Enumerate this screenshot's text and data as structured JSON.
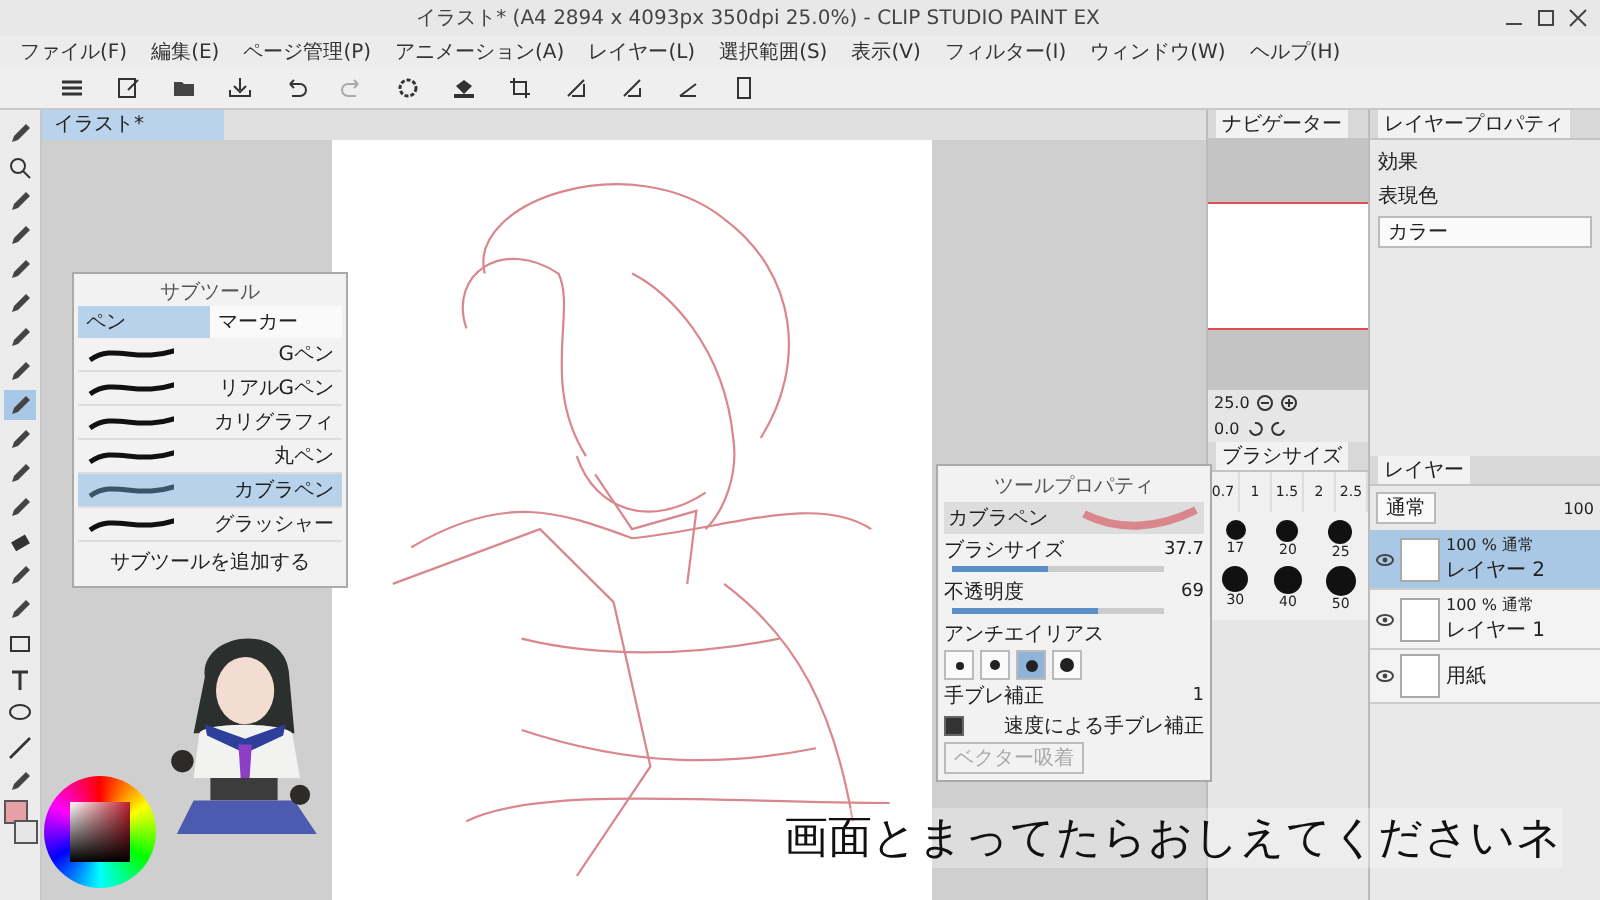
{
  "window": {
    "title": "イラスト* (A4 2894 x 4093px 350dpi 25.0%) - CLIP STUDIO PAINT EX"
  },
  "menu": [
    "ファイル(F)",
    "編集(E)",
    "ページ管理(P)",
    "アニメーション(A)",
    "レイヤー(L)",
    "選択範囲(S)",
    "表示(V)",
    "フィルター(I)",
    "ウィンドウ(W)",
    "ヘルプ(H)"
  ],
  "canvas_tab": {
    "label": "イラスト*"
  },
  "tools": [
    {
      "selected": false
    },
    {
      "selected": false
    },
    {
      "selected": false
    },
    {
      "selected": false
    },
    {
      "selected": false
    },
    {
      "selected": false
    },
    {
      "selected": false
    },
    {
      "selected": false
    },
    {
      "selected": true
    },
    {
      "selected": false
    },
    {
      "selected": false
    },
    {
      "selected": false
    },
    {
      "selected": false
    },
    {
      "selected": false
    },
    {
      "selected": false
    },
    {
      "selected": false
    },
    {
      "selected": false
    },
    {
      "selected": false
    },
    {
      "selected": false
    },
    {
      "selected": false
    }
  ],
  "sub_tool_panel": {
    "title": "サブツール",
    "tabs": [
      {
        "label": "ペン",
        "selected": true
      },
      {
        "label": "マーカー",
        "selected": false
      }
    ],
    "items": [
      {
        "label": "Gペン",
        "selected": false
      },
      {
        "label": "リアルGペン",
        "selected": false
      },
      {
        "label": "カリグラフィ",
        "selected": false
      },
      {
        "label": "丸ペン",
        "selected": false
      },
      {
        "label": "カブラペン",
        "selected": true
      },
      {
        "label": "グラッシャー",
        "selected": false
      }
    ],
    "add_button": "サブツールを追加する"
  },
  "tool_property": {
    "title": "ツールプロパティ",
    "preset": "カブラペン",
    "sliders": [
      {
        "label": "ブラシサイズ",
        "value": "37.7",
        "level": 0.45
      },
      {
        "label": "不透明度",
        "value": "69",
        "level": 0.69
      }
    ],
    "antialias": {
      "label": "アンチエイリアス",
      "options": [
        {
          "selected": false
        },
        {
          "selected": false
        },
        {
          "selected": true
        },
        {
          "selected": false
        }
      ]
    },
    "stabilization": {
      "label": "手ブレ補正",
      "value": "1"
    },
    "speed_stabilization": {
      "label": "速度による手ブレ補正",
      "checked": true
    },
    "vector_snap": {
      "label": "ベクター吸着",
      "disabled": true
    }
  },
  "navigator": {
    "tab": "ナビゲーター",
    "zoom": "25.0",
    "rotation": "0.0"
  },
  "brush_size_panel": {
    "tab": "ブラシサイズ",
    "grid_sizes": [
      "0.7",
      "1",
      "1.5",
      "2",
      "2.5"
    ],
    "dot_sizes": [
      "17",
      "20",
      "25",
      "30",
      "40",
      "50"
    ]
  },
  "layer_property": {
    "tab": "レイヤープロパティ",
    "effect_label": "効果",
    "color_label": "表現色",
    "color_value": "カラー"
  },
  "layers_panel": {
    "tab": "レイヤー",
    "blend_mode": "通常",
    "opacity": "100",
    "layers": [
      {
        "mode": "100 % 通常",
        "name": "レイヤー 2",
        "selected": true
      },
      {
        "mode": "100 % 通常",
        "name": "レイヤー 1",
        "selected": false
      },
      {
        "name": "用紙",
        "selected": false
      }
    ]
  },
  "subtitle": "画面とまってたらおしえてくださいネ"
}
